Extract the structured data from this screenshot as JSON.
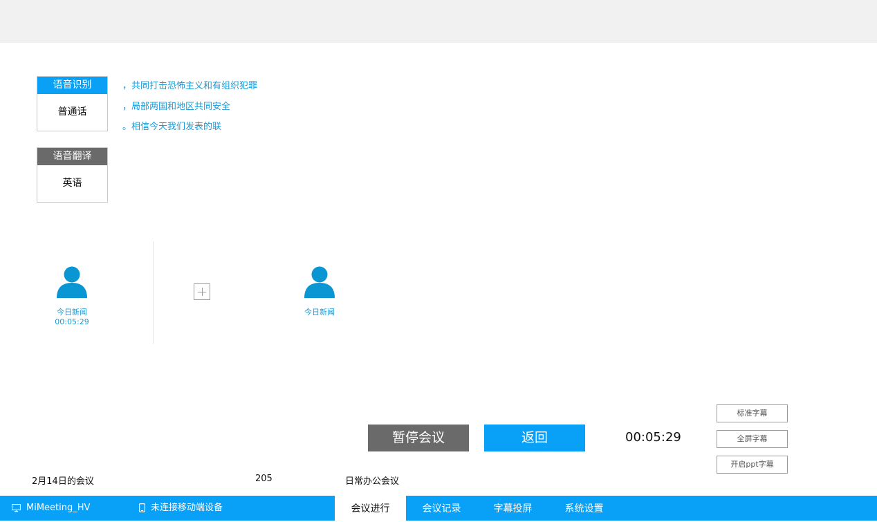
{
  "recognition": {
    "header": "语音识别",
    "value": "普通话"
  },
  "translation": {
    "header": "语音翻译",
    "value": "英语"
  },
  "transcript": [
    "，共同打击恐怖主义和有组织犯罪",
    "，局部两国和地区共同安全",
    "。相信今天我们发表的联"
  ],
  "participants": [
    {
      "name": "今日新闻",
      "time": "00:05:29"
    },
    {
      "name": "今日新闻"
    }
  ],
  "controls": {
    "pause_label": "暂停会议",
    "back_label": "返回",
    "timer": "00:05:29"
  },
  "subtitle_buttons": [
    "标准字幕",
    "全屏字幕",
    "开启ppt字幕"
  ],
  "meeting": {
    "title": "2月14日的会议",
    "room": "205",
    "type": "日常办公会议"
  },
  "statusbar": {
    "device": "MiMeeting_HV",
    "mobile": "未连接移动端设备"
  },
  "tabs": [
    {
      "label": "会议进行",
      "active": true
    },
    {
      "label": "会议记录",
      "active": false
    },
    {
      "label": "字幕投屏",
      "active": false
    },
    {
      "label": "系统设置",
      "active": false
    }
  ],
  "colors": {
    "accent": "#09a0f7",
    "avatar": "#0a96d2",
    "text_blue": "#1a9bd8",
    "gray_button": "#6a6a6a"
  }
}
